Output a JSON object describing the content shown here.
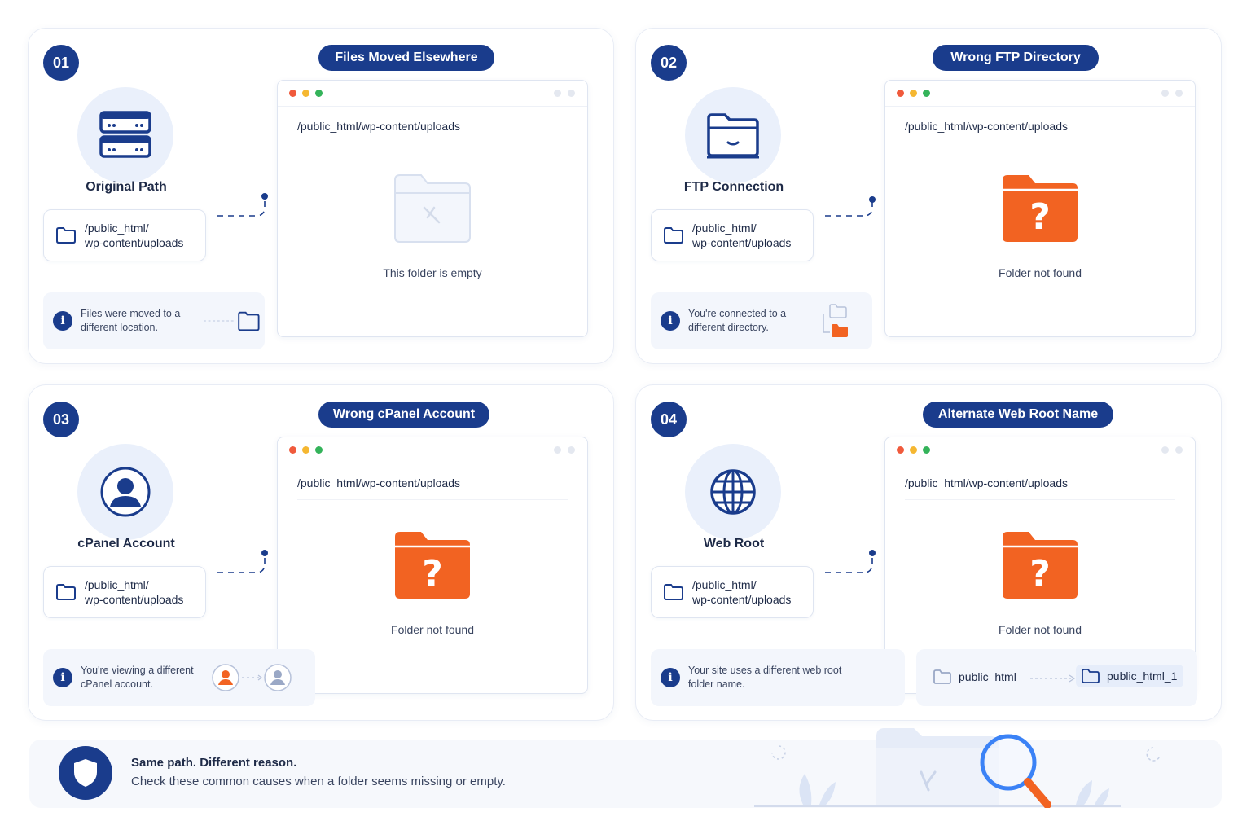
{
  "cards": [
    {
      "number": "01",
      "title": "Files Moved Elsewhere",
      "icon_label": "Original Path",
      "icon": "server-icon",
      "path_line1": "/public_html/",
      "path_line2": "wp-content/uploads",
      "info_text": "Files were moved to a different location.",
      "browser_path": "/public_html/wp-content/uploads",
      "browser_message": "This folder is empty",
      "browser_state": "empty-folder"
    },
    {
      "number": "02",
      "title": "Wrong FTP Directory",
      "icon_label": "FTP Connection",
      "icon": "ftp-folder-icon",
      "path_line1": "/public_html/",
      "path_line2": "wp-content/uploads",
      "info_text": "You're connected to a different directory.",
      "browser_path": "/public_html/wp-content/uploads",
      "browser_message": "Folder not found",
      "browser_state": "missing-folder"
    },
    {
      "number": "03",
      "title": "Wrong cPanel Account",
      "icon_label": "cPanel Account",
      "icon": "user-icon",
      "path_line1": "/public_html/",
      "path_line2": "wp-content/uploads",
      "info_text": "You're viewing a different cPanel account.",
      "browser_path": "/public_html/wp-content/uploads",
      "browser_message": "Folder not found",
      "browser_state": "missing-folder"
    },
    {
      "number": "04",
      "title": "Alternate Web Root Name",
      "icon_label": "Web Root",
      "icon": "globe-icon",
      "path_line1": "/public_html/",
      "path_line2": "wp-content/uploads",
      "info_text": "Your site uses a different web root folder name.",
      "browser_path": "/public_html/wp-content/uploads",
      "browser_message": "Folder not found",
      "browser_state": "missing-folder",
      "root_from": "public_html",
      "root_to": "public_html_1"
    }
  ],
  "banner": {
    "title": "Same path. Different reason.",
    "subtitle": "Check these common causes when a folder seems missing or empty.",
    "icon": "shield-icon"
  },
  "colors": {
    "navy": "#1a3c8c",
    "orange": "#f26322",
    "light_blue": "#eaf0fb"
  }
}
